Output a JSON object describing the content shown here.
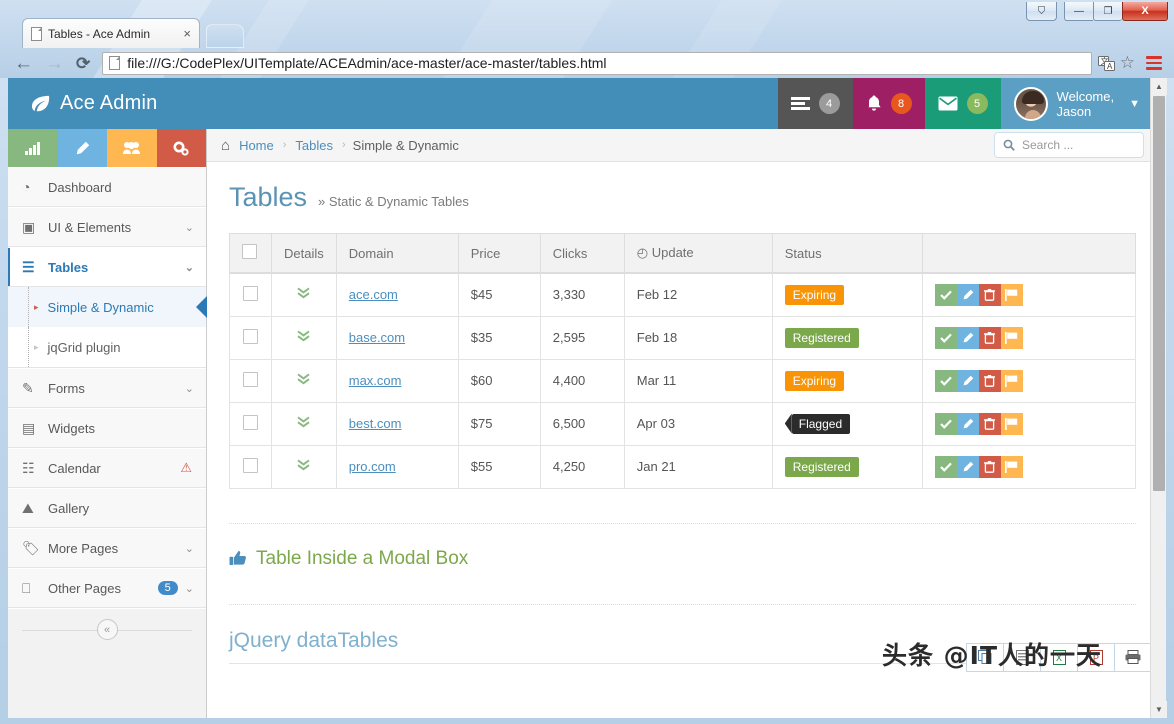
{
  "browser": {
    "tab_title": "Tables - Ace Admin",
    "tab_close": "×",
    "url": "file:///G:/CodePlex/UITemplate/ACEAdmin/ace-master/ace-master/tables.html",
    "back_icon": "←",
    "forward_icon": "→",
    "reload_icon": "⟳",
    "translate_icon": "translate-icon",
    "bookmark_icon": "☆",
    "menu_icon": "hamburger-menu-icon",
    "window": {
      "user_btn": "⛉",
      "minimize": "—",
      "maximize": "❐",
      "close": "X"
    }
  },
  "navbar": {
    "brand": "Ace Admin",
    "brand_icon": "leaf-icon",
    "tasks": {
      "icon": "tasks-icon",
      "count": "4"
    },
    "notifications": {
      "icon": "bell-icon",
      "count": "8"
    },
    "messages": {
      "icon": "envelope-icon",
      "count": "5"
    },
    "user": {
      "welcome_label": "Welcome,",
      "name": "Jason",
      "caret": "▼"
    }
  },
  "shortcuts": [
    {
      "name": "chart-shortcut",
      "icon": "📊",
      "color": "#87b87f"
    },
    {
      "name": "edit-shortcut",
      "icon": "✎",
      "color": "#6fb3e0"
    },
    {
      "name": "users-shortcut",
      "icon": "👥",
      "color": "#ffb752"
    },
    {
      "name": "settings-shortcut",
      "icon": "⚙",
      "color": "#d15b47"
    }
  ],
  "sidebar": {
    "items": [
      {
        "label": "Dashboard",
        "icon": "◔",
        "caret": "",
        "badge": "",
        "warn": false
      },
      {
        "label": "UI & Elements",
        "icon": "▣",
        "caret": "⌄",
        "badge": "",
        "warn": false
      },
      {
        "label": "Tables",
        "icon": "☰",
        "caret": "⌄",
        "badge": "",
        "warn": false,
        "active": true
      },
      {
        "label": "Forms",
        "icon": "✎",
        "caret": "⌄",
        "badge": "",
        "warn": false
      },
      {
        "label": "Widgets",
        "icon": "▤",
        "caret": "",
        "badge": "",
        "warn": false
      },
      {
        "label": "Calendar",
        "icon": "☷",
        "caret": "",
        "badge": "",
        "warn": true
      },
      {
        "label": "Gallery",
        "icon": "⛰",
        "caret": "",
        "badge": "",
        "warn": false
      },
      {
        "label": "More Pages",
        "icon": "🏷",
        "caret": "⌄",
        "badge": "",
        "warn": false
      },
      {
        "label": "Other Pages",
        "icon": "⎕",
        "caret": "⌄",
        "badge": "5",
        "warn": false
      }
    ],
    "submenu": [
      {
        "label": "Simple & Dynamic",
        "active": true
      },
      {
        "label": "jqGrid plugin",
        "active": false
      }
    ],
    "collapse_icon": "«"
  },
  "breadcrumbs": {
    "home_icon": "⌂",
    "home": "Home",
    "section": "Tables",
    "current": "Simple & Dynamic",
    "separator": "›"
  },
  "search": {
    "icon": "⚲",
    "placeholder": "Search ...",
    "value": ""
  },
  "page": {
    "title": "Tables",
    "subtitle": "» Static & Dynamic Tables",
    "settings_icon": "⚙"
  },
  "table": {
    "columns": [
      "",
      "Details",
      "Domain",
      "Price",
      "Clicks",
      "Update",
      "Status",
      ""
    ],
    "update_icon": "◴",
    "detail_icon": "»",
    "rows": [
      {
        "domain": "ace.com",
        "price": "$45",
        "clicks": "3,330",
        "update": "Feb 12",
        "status": "Expiring",
        "status_style": "orange"
      },
      {
        "domain": "base.com",
        "price": "$35",
        "clicks": "2,595",
        "update": "Feb 18",
        "status": "Registered",
        "status_style": "green"
      },
      {
        "domain": "max.com",
        "price": "$60",
        "clicks": "4,400",
        "update": "Mar 11",
        "status": "Expiring",
        "status_style": "orange"
      },
      {
        "domain": "best.com",
        "price": "$75",
        "clicks": "6,500",
        "update": "Apr 03",
        "status": "Flagged",
        "status_style": "dark"
      },
      {
        "domain": "pro.com",
        "price": "$55",
        "clicks": "4,250",
        "update": "Jan 21",
        "status": "Registered",
        "status_style": "green"
      }
    ],
    "row_actions": [
      {
        "name": "approve-button",
        "icon": "✔",
        "color": "#87b87f"
      },
      {
        "name": "edit-button",
        "icon": "✎",
        "color": "#6fb3e0"
      },
      {
        "name": "delete-button",
        "icon": "🗑",
        "color": "#d15b47"
      },
      {
        "name": "flag-button",
        "icon": "⚑",
        "color": "#ffb752"
      }
    ]
  },
  "sections": {
    "modal_heading": "Table Inside a Modal Box",
    "modal_icon": "☝",
    "datatables_heading": "jQuery dataTables"
  },
  "export_buttons": [
    {
      "name": "copy-export-button",
      "icon": "❐"
    },
    {
      "name": "csv-export-button",
      "icon": "▤"
    },
    {
      "name": "excel-export-button",
      "icon": "▦"
    },
    {
      "name": "pdf-export-button",
      "icon": "▧"
    },
    {
      "name": "print-button",
      "icon": "⎙"
    }
  ],
  "watermark": "头条 @IT人的一天",
  "colors": {
    "brand_blue": "#438eb9",
    "green": "#87b87f",
    "orange": "#ffb752",
    "red": "#d15b47",
    "light_blue": "#6fb3e0"
  }
}
